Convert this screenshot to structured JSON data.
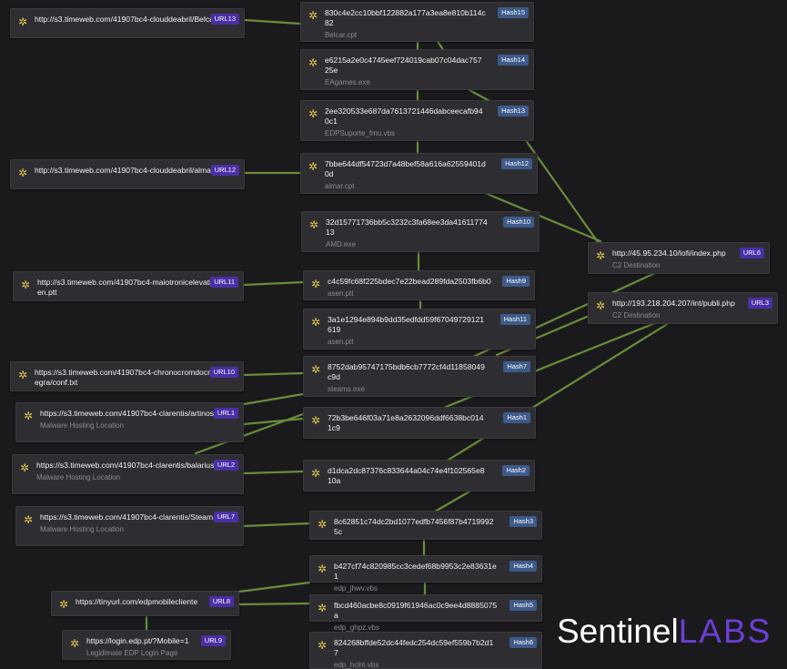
{
  "colors": {
    "background": "#1a1a1d",
    "node_bg": "#2e2e32",
    "edge": "#6a8c3a",
    "url_badge": "#4b2fa6",
    "hash_badge": "#3d5a8a",
    "icon": "#e6c84a",
    "logo_accent": "#6b3fd4"
  },
  "node_icon": "gear-icon",
  "nodes": {
    "url13": {
      "title": "http://s3.timeweb.com/41907bc4-clouddeabril/Belcar.cpt",
      "badge": "URL13"
    },
    "url12": {
      "title": "http://s3.timeweb.com/41907bc4-clouddeabril/almar.cpt",
      "badge": "URL12"
    },
    "url11": {
      "title": "http://s3.timeweb.com/41907bc4-maiotronicelevation/asen.ptt",
      "badge": "URL11"
    },
    "url10": {
      "title": "https://s3.timeweb.com/41907bc4-chronocromdocrom/integra/conf.txt",
      "badge": "URL10"
    },
    "url1": {
      "title": "https://s3.timeweb.com/41907bc4-clarentis/artinos.cpp",
      "sub": "Malware Hosting Location",
      "badge": "URL1"
    },
    "url2": {
      "title": "https://s3.timeweb.com/41907bc4-clarentis/balarius.cpp",
      "sub": "Malware Hosting Location",
      "badge": "URL2"
    },
    "url7": {
      "title": "https://s3.timeweb.com/41907bc4-clarentis/Steam.cpp",
      "sub": "Malware Hosting Location",
      "badge": "URL7"
    },
    "url8": {
      "title": "https://tinyurl.com/edpmobilecliente",
      "badge": "URL8"
    },
    "url9": {
      "title": "https://login.edp.pt/?Mobile=1",
      "sub": "Legidimate EDP Login Page",
      "badge": "URL9"
    },
    "url6": {
      "title": "http://45.95.234.10/lofi/index.php",
      "sub": "C2 Destination",
      "badge": "URL6"
    },
    "url3": {
      "title": "http://193.218.204.207/int/publi.php",
      "sub": "C2 Destination",
      "badge": "URL3"
    },
    "hash15": {
      "title": "830c4e2cc10bbf122882a177a3ea8e810b114c82",
      "sub": "Belcar.cpt",
      "badge": "Hash15"
    },
    "hash14": {
      "title": "e6215a2e0c4745eef724019cab07c04dac75725e",
      "sub": "EAgames.exe",
      "badge": "Hash14"
    },
    "hash13": {
      "title": "2ee320533e687da7613721446dabceecafb940c1",
      "sub": "EDPSuporte_fmu.vbs",
      "badge": "Hash13"
    },
    "hash12": {
      "title": "7bbe644df54723d7a48bef58a616a62559401d0d",
      "sub": "almar.cpt",
      "badge": "Hash12"
    },
    "hash10": {
      "title": "32d15771736bb5c3232c3fa68ee3da4161177413",
      "sub": "AMD.exe",
      "badge": "Hash10"
    },
    "hash9": {
      "title": "c4c59fc68f225bdec7e22bead289fda2503fb6b0",
      "sub": "asen.ptt",
      "badge": "Hash9"
    },
    "hash11": {
      "title": "3a1e1294e894b9dd35edfdd59f67049729121619",
      "sub": "asen.ptt",
      "badge": "Hash11"
    },
    "hash7": {
      "title": "8752dab95747175bdb6cb7772cf4d11858049c9d",
      "sub": "steams.exe",
      "badge": "Hash7"
    },
    "hash1": {
      "title": "72b3be646f03a71e8a2632096ddf6638bc0141c9",
      "badge": "Hash1"
    },
    "hash2": {
      "title": "d1dca2dc87376c833644a04c74e4f102565e810a",
      "badge": "Hash2"
    },
    "hash3": {
      "title": "8c62851c74dc2bd1077edfb7456f87b47199925c",
      "badge": "Hash3"
    },
    "hash4": {
      "title": "b427cf74c820985cc3cedef68b9953c2e83631e1",
      "sub": "edp_jhwv.vbs",
      "badge": "Hash4"
    },
    "hash5": {
      "title": "fbcd460acbe8c0919f61946ac0c9ee4d8885075a",
      "sub": "edp_ghpz.vbs",
      "badge": "Hash5"
    },
    "hash6": {
      "title": "824268bffde52dc44fedc254dc59ef559b7b2d17",
      "sub": "edp_hclm.vbs",
      "badge": "Hash6"
    }
  },
  "logo": {
    "part1": "Sentinel",
    "part2": "LABS"
  }
}
